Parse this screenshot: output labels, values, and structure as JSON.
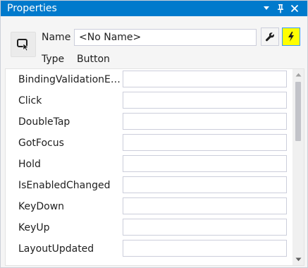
{
  "window": {
    "title": "Properties",
    "controls": {
      "dropdown_icon": "triangle-down-icon",
      "pin_icon": "pin-icon",
      "close_icon": "close-icon"
    },
    "accent_color": "#007acc"
  },
  "header": {
    "element_icon": "button-element-icon",
    "name_label": "Name",
    "name_value": "<No Name>",
    "type_label": "Type",
    "type_value": "Button",
    "properties_button_icon": "wrench-icon",
    "events_button_icon": "lightning-bolt-icon",
    "events_button_active": true,
    "events_button_highlight_color": "#ffff00"
  },
  "events": [
    {
      "label": "BindingValidationEr...",
      "value": ""
    },
    {
      "label": "Click",
      "value": ""
    },
    {
      "label": "DoubleTap",
      "value": ""
    },
    {
      "label": "GotFocus",
      "value": ""
    },
    {
      "label": "Hold",
      "value": ""
    },
    {
      "label": "IsEnabledChanged",
      "value": ""
    },
    {
      "label": "KeyDown",
      "value": ""
    },
    {
      "label": "KeyUp",
      "value": ""
    },
    {
      "label": "LayoutUpdated",
      "value": ""
    }
  ],
  "scrollbar": {
    "up_icon": "scroll-up-arrow-icon",
    "down_icon": "scroll-down-arrow-icon"
  }
}
